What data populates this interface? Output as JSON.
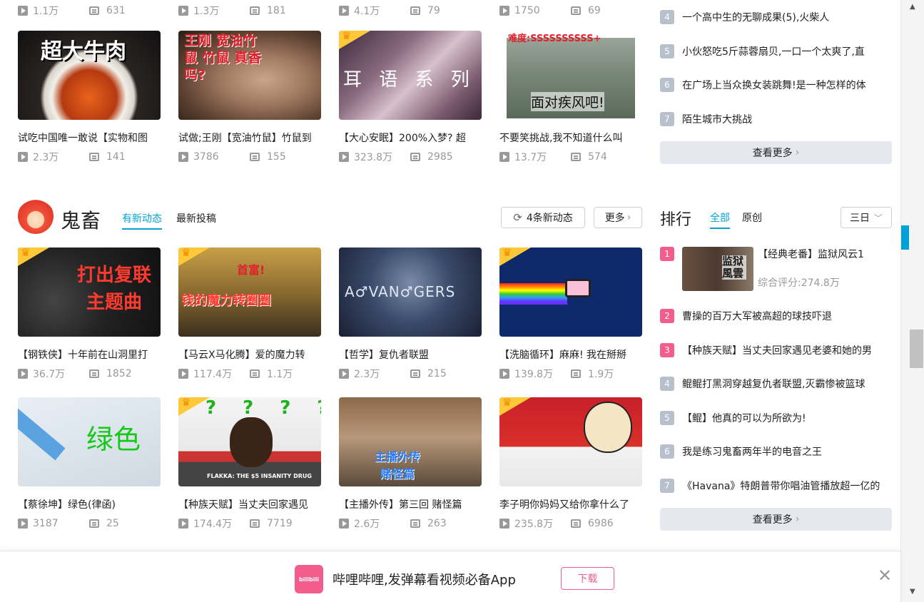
{
  "top_stats": [
    [
      "1.1万",
      "631"
    ],
    [
      "1.3万",
      "181"
    ],
    [
      "4.1万",
      "79"
    ],
    [
      "1750",
      "69"
    ]
  ],
  "row1": [
    {
      "title": "试吃中国唯一敢说【实物和图",
      "plays": "2.3万",
      "danmaku": "141",
      "caption": "超大牛肉"
    },
    {
      "title": "试做;王刚【宽油竹鼠】竹鼠到",
      "plays": "3786",
      "danmaku": "155",
      "caption": "王刚 宽油竹鼠 竹鼠 真香吗?"
    },
    {
      "title": "【大心安眠】200%入梦? 超",
      "plays": "323.8万",
      "danmaku": "2985",
      "caption": "耳 语 系 列"
    },
    {
      "title": "不要笑挑战,我不知道什么叫",
      "plays": "13.7万",
      "danmaku": "574",
      "caption": "面对疾风吧!",
      "caption2": "难度:SSSSSSSSSS+"
    }
  ],
  "section": {
    "title": "鬼畜",
    "tab_active": "有新动态",
    "tab_2": "最新投稿",
    "new_btn": "4条新动态",
    "new_count": "4",
    "more_btn": "更多"
  },
  "row2": [
    {
      "title": "【钢铁侠】十年前在山洞里打",
      "plays": "36.7万",
      "danmaku": "1852",
      "caption": "打出复联 主题曲"
    },
    {
      "title": "【马云X马化腾】爱的魔力转",
      "plays": "117.4万",
      "danmaku": "1.1万",
      "caption": "钱的魔力转圈圈",
      "caption2": "首富!"
    },
    {
      "title": "【哲学】复仇者联盟",
      "plays": "2.3万",
      "danmaku": "215",
      "caption": "A♂VAN♂GERS"
    },
    {
      "title": "【洗脑循环】麻麻! 我在掰掰",
      "plays": "139.8万",
      "danmaku": "1.9万"
    }
  ],
  "row3": [
    {
      "title": "【蔡徐坤】绿色(律函)",
      "plays": "3187",
      "danmaku": "25",
      "caption": "绿色"
    },
    {
      "title": "【种族天赋】当丈夫回家遇见",
      "plays": "174.4万",
      "danmaku": "7719",
      "caption": "? ? ? ?",
      "caption2": "FLAKKA: THE $5 INSANITY DRUG"
    },
    {
      "title": "【主播外传】第三回 赌怪篇",
      "plays": "2.6万",
      "danmaku": "263",
      "caption": "主播外传 赌怪篇"
    },
    {
      "title": "李子明你妈妈又给你拿什么了",
      "plays": "235.8万",
      "danmaku": "6986"
    }
  ],
  "side_top": [
    {
      "n": "4",
      "t": "一个高中生的无聊成果(5),火柴人"
    },
    {
      "n": "5",
      "t": "小伙怒吃5斤蒜蓉扇贝,一口一个太爽了,直"
    },
    {
      "n": "6",
      "t": "在广场上当众换女装跳舞!是一种怎样的体"
    },
    {
      "n": "7",
      "t": "陌生城市大挑战"
    }
  ],
  "see_more": "查看更多",
  "rank": {
    "title": "排行",
    "tab_all": "全部",
    "tab_orig": "原创",
    "range": "三日",
    "first": {
      "n": "1",
      "t": "【经典老番】监狱风云1",
      "score": "综合评分:274.8万",
      "thumb": "监狱 風雲"
    },
    "items": [
      {
        "n": "2",
        "t": "曹操的百万大军被高超的球技吓退"
      },
      {
        "n": "3",
        "t": "【种族天赋】当丈夫回家遇见老婆和她的男"
      },
      {
        "n": "4",
        "t": "鲲鲲打黑洞穿越复仇者联盟,灭霸惨被篮球"
      },
      {
        "n": "5",
        "t": "【鲲】他真的可以为所欲为!"
      },
      {
        "n": "6",
        "t": "我是练习鬼畜两年半的电音之王"
      },
      {
        "n": "7",
        "t": "《Havana》特朗普带你唱油管播放超一亿的"
      }
    ]
  },
  "app_bar": {
    "logo": "bilibili",
    "text": "哔哩哔哩,发弹幕看视频必备App",
    "download": "下载"
  },
  "colors": {
    "accent": "#00a1d6",
    "pink": "#f25d8e",
    "grey": "#b8c0cc"
  }
}
